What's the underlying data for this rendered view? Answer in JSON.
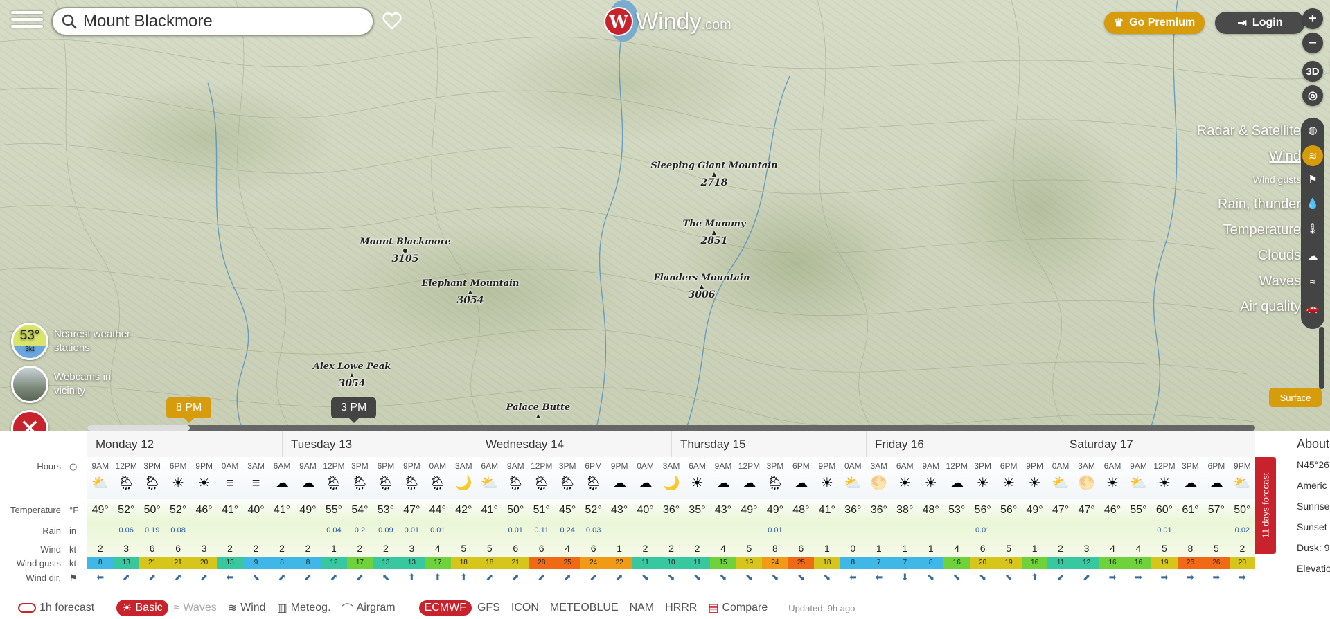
{
  "search": {
    "value": "Mount Blackmore"
  },
  "logo": {
    "letter": "W",
    "name": "Windy",
    "suffix": ".com"
  },
  "top_buttons": {
    "premium": "Go Premium",
    "login": "Login"
  },
  "map_controls": {
    "zoom_in": "+",
    "zoom_out": "−",
    "three_d": "3D"
  },
  "layers": [
    {
      "label": "Radar & Satellite",
      "icon": "globe-icon"
    },
    {
      "label": "Wind",
      "icon": "wind-icon",
      "active": true
    },
    {
      "label": "Wind gusts",
      "icon": "flag-icon"
    },
    {
      "label": "Rain, thunder",
      "icon": "drop-icon"
    },
    {
      "label": "Temperature",
      "icon": "thermometer-icon"
    },
    {
      "label": "Clouds",
      "icon": "cloud-icon"
    },
    {
      "label": "Waves",
      "icon": "waves-icon"
    },
    {
      "label": "Air quality",
      "icon": "car-icon"
    }
  ],
  "surface": "Surface",
  "peaks": [
    {
      "name": "Sleeping Giant Mountain",
      "elev": "2718"
    },
    {
      "name": "The Mummy",
      "elev": "2851"
    },
    {
      "name": "Mount Blackmore",
      "elev": "3105"
    },
    {
      "name": "Elephant Mountain",
      "elev": "3054"
    },
    {
      "name": "Flanders Mountain",
      "elev": "3006"
    },
    {
      "name": "Alex Lowe Peak",
      "elev": "3054"
    },
    {
      "name": "Palace Butte",
      "elev": "3017"
    }
  ],
  "nearest": {
    "temp": "53°",
    "wind": "3kt",
    "label1": "Nearest weather",
    "label2": "stations"
  },
  "webcams": {
    "label1": "Webcams in",
    "label2": "vicinity"
  },
  "timeline": {
    "current": "8 PM",
    "selected": "3 PM"
  },
  "days": [
    "Monday 12",
    "Tuesday 13",
    "Wednesday 14",
    "Thursday 15",
    "Friday 16",
    "Saturday 17"
  ],
  "row_labels": {
    "hours": "Hours",
    "temperature": "Temperature",
    "temp_unit": "°F",
    "rain": "Rain",
    "rain_unit": "in",
    "wind": "Wind",
    "wind_unit": "kt",
    "gusts": "Wind gusts",
    "gust_unit": "kt",
    "dir": "Wind dir."
  },
  "hours": [
    "9AM",
    "12PM",
    "3PM",
    "6PM",
    "9PM",
    "0AM",
    "3AM",
    "6AM",
    "9AM",
    "12PM",
    "3PM",
    "6PM",
    "9PM",
    "0AM",
    "3AM",
    "6AM",
    "9AM",
    "12PM",
    "3PM",
    "6PM",
    "9PM",
    "0AM",
    "3AM",
    "6AM",
    "9AM",
    "12PM",
    "3PM",
    "6PM",
    "9PM",
    "0AM",
    "3AM",
    "6AM",
    "9AM",
    "12PM",
    "3PM",
    "6PM",
    "9PM",
    "0AM",
    "3AM",
    "6AM",
    "9AM",
    "12PM",
    "3PM",
    "6PM",
    "9PM"
  ],
  "weather_icons": [
    "⛅",
    "🌦",
    "🌦",
    "☀",
    "☀",
    "≡",
    "≡",
    "☁",
    "☁",
    "🌦",
    "🌦",
    "🌦",
    "🌦",
    "🌦",
    "🌙",
    "⛅",
    "🌦",
    "🌦",
    "🌦",
    "🌦",
    "☁",
    "☁",
    "🌙",
    "☀",
    "☁",
    "☁",
    "🌦",
    "☁",
    "☀",
    "⛅",
    "🌕",
    "☀",
    "☀",
    "☁",
    "☀",
    "☀",
    "☀",
    "⛅",
    "🌕",
    "☀",
    "⛅",
    "☀",
    "☁",
    "☁",
    "⛅"
  ],
  "temps": [
    "49°",
    "52°",
    "50°",
    "52°",
    "46°",
    "41°",
    "40°",
    "41°",
    "49°",
    "55°",
    "54°",
    "53°",
    "47°",
    "44°",
    "42°",
    "41°",
    "50°",
    "51°",
    "45°",
    "52°",
    "43°",
    "40°",
    "36°",
    "35°",
    "43°",
    "49°",
    "49°",
    "48°",
    "41°",
    "36°",
    "36°",
    "38°",
    "48°",
    "53°",
    "56°",
    "56°",
    "49°",
    "47°",
    "47°",
    "46°",
    "55°",
    "60°",
    "61°",
    "57°",
    "50°"
  ],
  "rain": [
    "",
    "0.06",
    "0.19",
    "0.08",
    "",
    "",
    "",
    "",
    "",
    "0.04",
    "0.2",
    "0.09",
    "0.01",
    "0.01",
    "",
    "",
    "0.01",
    "0.11",
    "0.24",
    "0.03",
    "",
    "",
    "",
    "",
    "",
    "",
    "0.01",
    "",
    "",
    "",
    "",
    "",
    "",
    "",
    "0.01",
    "",
    "",
    "",
    "",
    "",
    "",
    "0.01",
    "",
    "",
    "0.02"
  ],
  "wind": [
    "2",
    "3",
    "6",
    "6",
    "3",
    "2",
    "2",
    "2",
    "2",
    "1",
    "2",
    "2",
    "3",
    "4",
    "5",
    "5",
    "6",
    "6",
    "4",
    "6",
    "1",
    "2",
    "2",
    "2",
    "4",
    "5",
    "8",
    "6",
    "1",
    "0",
    "1",
    "1",
    "1",
    "4",
    "6",
    "5",
    "1",
    "2",
    "3",
    "4",
    "4",
    "5",
    "8",
    "5",
    "2"
  ],
  "gusts": [
    "8",
    "13",
    "21",
    "21",
    "20",
    "13",
    "9",
    "8",
    "8",
    "12",
    "17",
    "13",
    "13",
    "17",
    "18",
    "18",
    "21",
    "28",
    "25",
    "24",
    "22",
    "11",
    "10",
    "11",
    "15",
    "19",
    "24",
    "25",
    "18",
    "8",
    "7",
    "7",
    "8",
    "16",
    "20",
    "19",
    "16",
    "11",
    "12",
    "16",
    "16",
    "19",
    "26",
    "26",
    "20"
  ],
  "wind_dir": [
    "⬅",
    "⬈",
    "⬈",
    "⬈",
    "⬈",
    "⬅",
    "⬉",
    "⬈",
    "⬈",
    "⬈",
    "⬈",
    "⬉",
    "⬆",
    "⬆",
    "⬆",
    "⬈",
    "⬈",
    "⬈",
    "⬈",
    "⬈",
    "⬈",
    "⬊",
    "⬊",
    "⬊",
    "⬊",
    "⬊",
    "⬊",
    "⬊",
    "⬊",
    "⬅",
    "⬅",
    "⬇",
    "⬊",
    "⬊",
    "⬊",
    "⬊",
    "⬆",
    "⬈",
    "⬈",
    "➡",
    "➡",
    "➡",
    "➡",
    "➡",
    "➡"
  ],
  "forecast_tab": "11 days forecast",
  "about": {
    "title": "About",
    "lat": "N45°26",
    "region": "Americ",
    "sunrise": "Sunrise",
    "sunset": "Sunset",
    "dusk": "Dusk: 9",
    "elev": "Elevatio"
  },
  "bottom": {
    "toggle": "1h forecast",
    "views": [
      "Basic",
      "Waves",
      "Wind",
      "Meteog.",
      "Airgram"
    ],
    "models": [
      "ECMWF",
      "GFS",
      "ICON",
      "METEOBLUE",
      "NAM",
      "HRRR"
    ],
    "compare": "Compare",
    "updated": "Updated: 9h ago"
  },
  "colors": {
    "accent": "#c8232c",
    "premium": "#d69c0b"
  }
}
